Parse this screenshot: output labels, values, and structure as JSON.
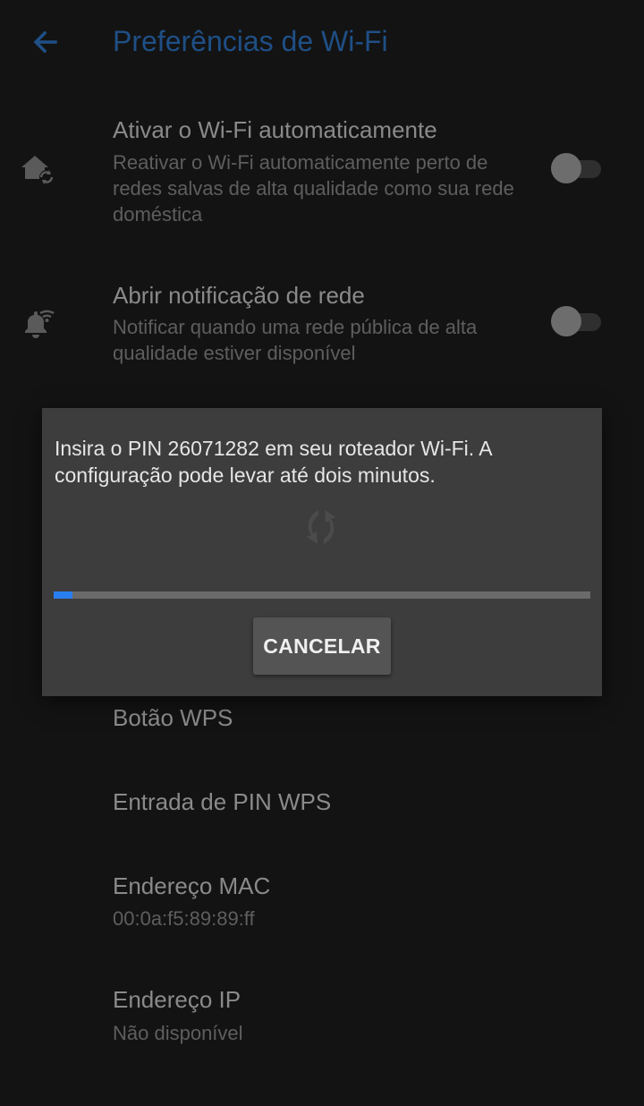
{
  "header": {
    "title": "Preferências de Wi-Fi",
    "back_icon": "arrow-back-icon"
  },
  "settings": {
    "auto_wifi": {
      "title": "Ativar o Wi-Fi automaticamente",
      "subtitle": "Reativar o Wi-Fi automaticamente perto de redes salvas de alta qualidade como sua rede doméstica",
      "icon": "home-sync-icon",
      "enabled": false
    },
    "network_notification": {
      "title": "Abrir notificação de rede",
      "subtitle": "Notificar quando uma rede pública de alta qualidade estiver disponível",
      "icon": "bell-wifi-icon",
      "enabled": false
    },
    "wps_button": {
      "title": "Botão WPS"
    },
    "wps_pin": {
      "title": "Entrada de PIN WPS"
    },
    "mac_address": {
      "title": "Endereço MAC",
      "value": "00:0a:f5:89:89:ff"
    },
    "ip_address": {
      "title": "Endereço IP",
      "value": "Não disponível"
    }
  },
  "dialog": {
    "message": "Insira o PIN 26071282 em seu roteador Wi-Fi. A configuração pode levar até dois minutos.",
    "icon": "wps-icon",
    "progress": 0.035,
    "cancel_label": "CANCELAR"
  },
  "colors": {
    "background": "#131313",
    "dialog": "#3d3d3d",
    "accent": "#2a7ff0",
    "title_accent": "#1f4f86"
  }
}
